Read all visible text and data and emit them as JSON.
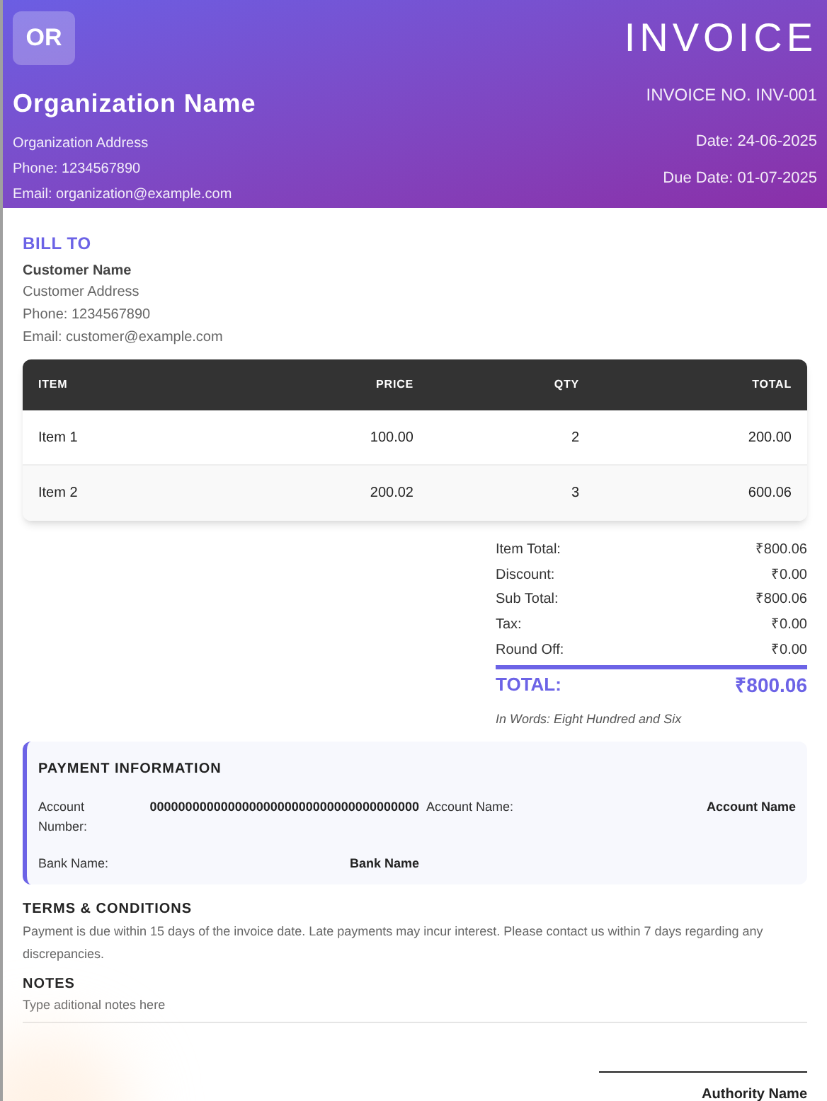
{
  "header": {
    "logo": "OR",
    "org_name": "Organization Name",
    "org_lines": [
      "Organization Address",
      "Phone: 1234567890",
      "Email: organization@example.com"
    ],
    "title": "INVOICE",
    "invoice_no": "INVOICE NO. INV-001",
    "date": "Date: 24-06-2025",
    "due_date": "Due Date: 01-07-2025"
  },
  "bill_to": {
    "heading": "BILL TO",
    "name": "Customer Name",
    "lines": [
      "Customer Address",
      "Phone: 1234567890",
      "Email: customer@example.com"
    ]
  },
  "table": {
    "columns": [
      "ITEM",
      "PRICE",
      "QTY",
      "TOTAL"
    ],
    "rows": [
      [
        "Item 1",
        "100.00",
        "2",
        "200.00"
      ],
      [
        "Item 2",
        "200.02",
        "3",
        "600.06"
      ]
    ]
  },
  "summary": [
    {
      "label": "Item Total:",
      "value": "₹800.06"
    },
    {
      "label": "Discount:",
      "value": "₹0.00"
    },
    {
      "label": "Sub Total:",
      "value": "₹800.06"
    },
    {
      "label": "Tax:",
      "value": "₹0.00"
    },
    {
      "label": "Round Off:",
      "value": "₹0.00"
    }
  ],
  "total": {
    "label": "TOTAL:",
    "value": "₹800.06"
  },
  "in_words": "In Words: Eight Hundred and Six",
  "payment": {
    "heading": "PAYMENT INFORMATION",
    "fields": [
      {
        "label": "Account Number:",
        "value": "00000000000000000000000000000000000000"
      },
      {
        "label": "Account Name:",
        "value": "Account Name"
      },
      {
        "label": "Bank Name:",
        "value": "Bank Name"
      }
    ]
  },
  "terms": {
    "heading": "TERMS & CONDITIONS",
    "text": "Payment is due within 15 days of the invoice date. Late payments may incur interest. Please contact us within 7 days regarding any discrepancies."
  },
  "notes": {
    "heading": "NOTES",
    "text": "Type aditional notes here"
  },
  "signature": {
    "label": "Authority Name"
  }
}
